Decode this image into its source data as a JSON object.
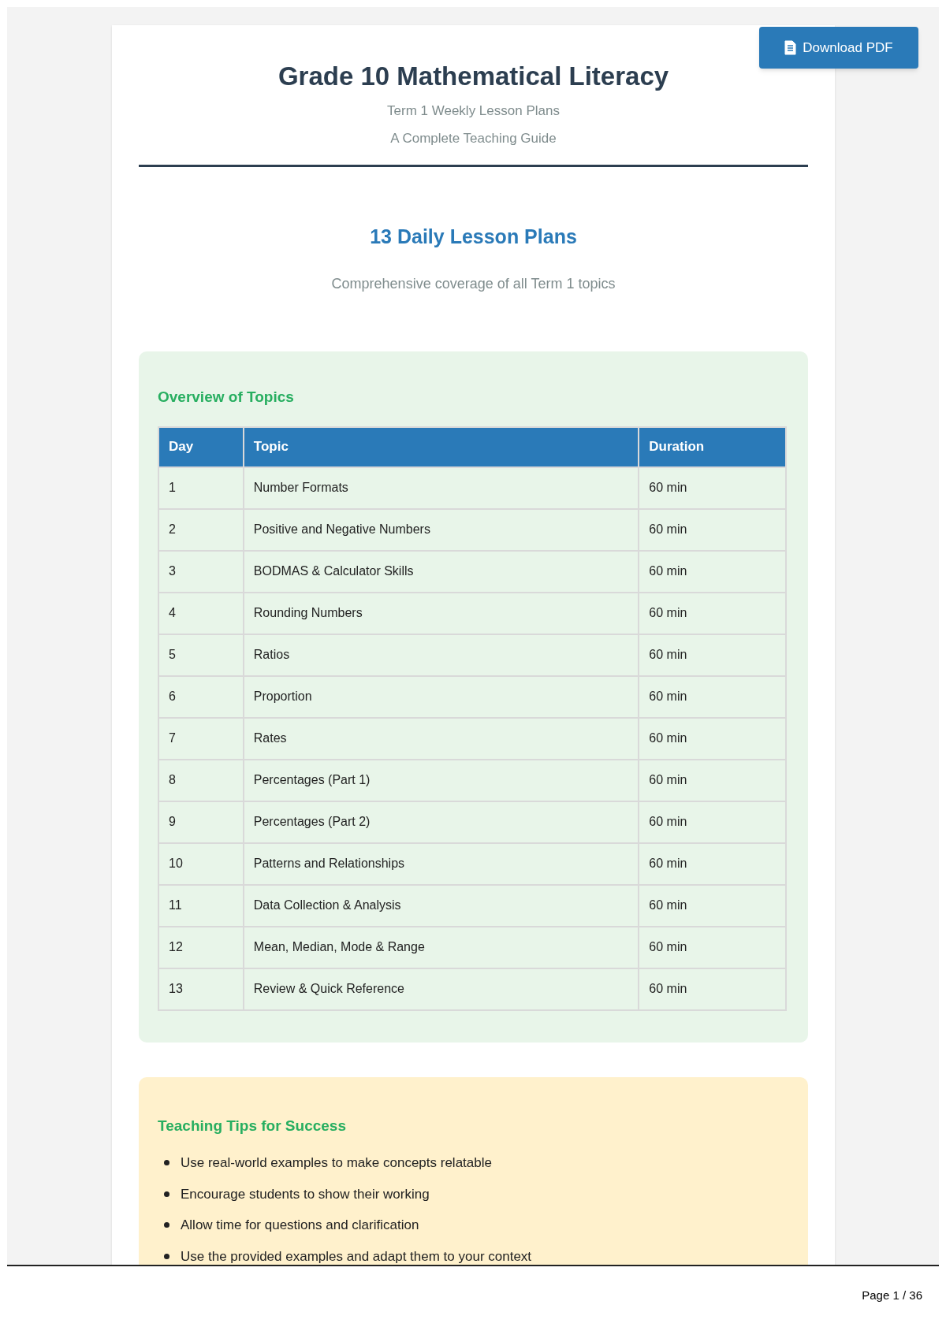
{
  "download_button": {
    "label": "Download PDF"
  },
  "header": {
    "title": "Grade 10 Mathematical Literacy",
    "subtitle": "Term 1 Weekly Lesson Plans",
    "tagline": "A Complete Teaching Guide"
  },
  "intro": {
    "heading": "13 Daily Lesson Plans",
    "text": "Comprehensive coverage of all Term 1 topics"
  },
  "overview": {
    "heading": "Overview of Topics",
    "columns": [
      "Day",
      "Topic",
      "Duration"
    ],
    "rows": [
      [
        "1",
        "Number Formats",
        "60 min"
      ],
      [
        "2",
        "Positive and Negative Numbers",
        "60 min"
      ],
      [
        "3",
        "BODMAS & Calculator Skills",
        "60 min"
      ],
      [
        "4",
        "Rounding Numbers",
        "60 min"
      ],
      [
        "5",
        "Ratios",
        "60 min"
      ],
      [
        "6",
        "Proportion",
        "60 min"
      ],
      [
        "7",
        "Rates",
        "60 min"
      ],
      [
        "8",
        "Percentages (Part 1)",
        "60 min"
      ],
      [
        "9",
        "Percentages (Part 2)",
        "60 min"
      ],
      [
        "10",
        "Patterns and Relationships",
        "60 min"
      ],
      [
        "11",
        "Data Collection & Analysis",
        "60 min"
      ],
      [
        "12",
        "Mean, Median, Mode & Range",
        "60 min"
      ],
      [
        "13",
        "Review & Quick Reference",
        "60 min"
      ]
    ]
  },
  "tips": {
    "heading": "Teaching Tips for Success",
    "items": [
      "Use real-world examples to make concepts relatable",
      "Encourage students to show their working",
      "Allow time for questions and clarification",
      "Use the provided examples and adapt them to your context"
    ]
  },
  "footer": {
    "page_indicator": "Page 1 / 36"
  }
}
